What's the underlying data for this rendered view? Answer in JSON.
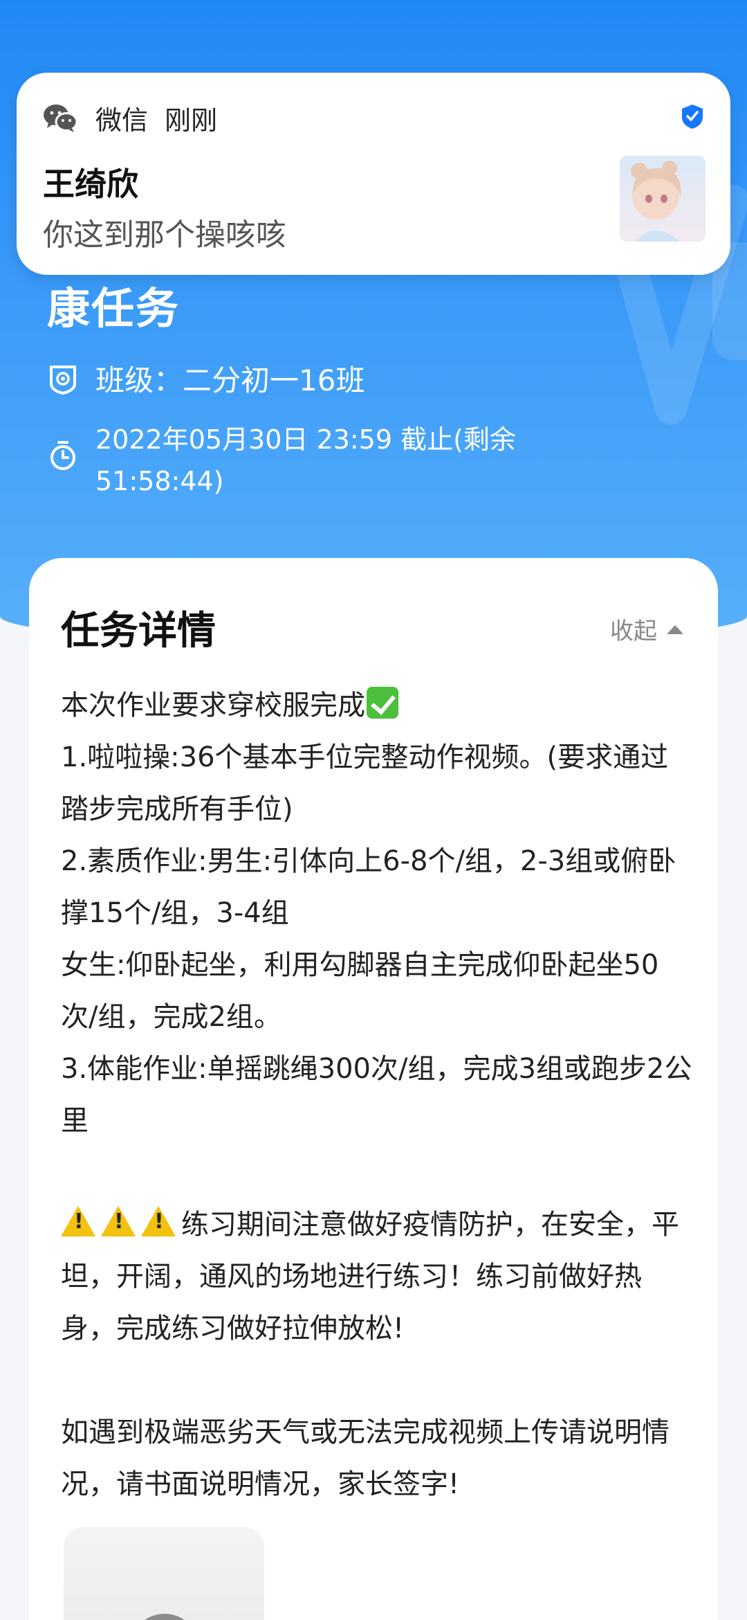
{
  "notification": {
    "app_name": "微信",
    "time": "刚刚",
    "sender": "王绮欣",
    "message": "你这到那个操咳咳"
  },
  "task": {
    "title_visible": "康任务",
    "class_label": "班级：二分初一16班",
    "deadline": "2022年05月30日 23:59 截止(剩余51:58:44)"
  },
  "detail": {
    "heading": "任务详情",
    "collapse_label": "收起",
    "line1": "本次作业要求穿校服完成",
    "line2": "1.啦啦操:36个基本手位完整动作视频。(要求通过踏步完成所有手位)",
    "line3": "2.素质作业:男生:引体向上6-8个/组，2-3组或俯卧撑15个/组，3-4组",
    "line4": "女生:仰卧起坐，利用勾脚器自主完成仰卧起坐50次/组，完成2组。",
    "line5": "3.体能作业:单摇跳绳300次/组，完成3组或跑步2公里",
    "warning": "练习期间注意做好疫情防护，在安全，平坦，开阔，通风的场地进行练习！练习前做好热身，完成练习做好拉伸放松!",
    "note": "如遇到极端恶劣天气或无法完成视频上传请说明情况，请书面说明情况，家长签字!"
  },
  "icons": {
    "wechat": "wechat-icon",
    "shield": "shield-check-icon",
    "class": "class-badge-icon",
    "deadline": "timer-icon",
    "collapse": "triangle-up-icon",
    "check": "check-mark-emoji",
    "warning": "warning-emoji",
    "play": "play-icon"
  },
  "colors": {
    "header_blue": "#2189f7",
    "wechat_gray": "#555555",
    "shield_blue": "#1677ff"
  }
}
